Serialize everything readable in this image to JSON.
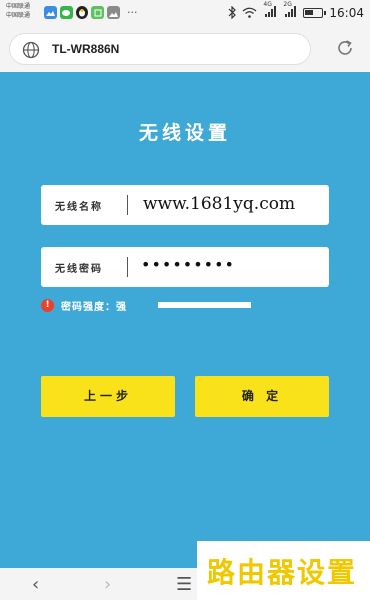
{
  "status_bar": {
    "carrier_line1": "中国联通",
    "carrier_line2": "中国联通",
    "more": "···",
    "network_1": "4G",
    "network_2": "2G",
    "battery_level": 0.55,
    "time": "16:04",
    "icons": [
      "image-icon",
      "wechat-icon",
      "qq-icon",
      "green-app-icon",
      "gallery-icon",
      "bluetooth-icon",
      "wifi-icon",
      "signal-icon",
      "signal-icon",
      "battery-icon"
    ]
  },
  "browser": {
    "url": "TL-WR886N"
  },
  "page": {
    "title": "无线设置",
    "ssid_label": "无线名称",
    "ssid_value": "www.1681yq.com",
    "password_label": "无线密码",
    "password_value": "•••••••••",
    "strength_label": "密码强度：强",
    "strength_level": 1.0,
    "prev_button": "上一步",
    "ok_button": "确 定"
  },
  "nav": {
    "back": "‹",
    "forward": "›",
    "menu": "☰"
  },
  "watermark": {
    "text": "路由器设置"
  },
  "colors": {
    "background": "#3ea9d6",
    "button": "#f9e219",
    "warning": "#e9422c",
    "watermark": "#f0c800"
  }
}
